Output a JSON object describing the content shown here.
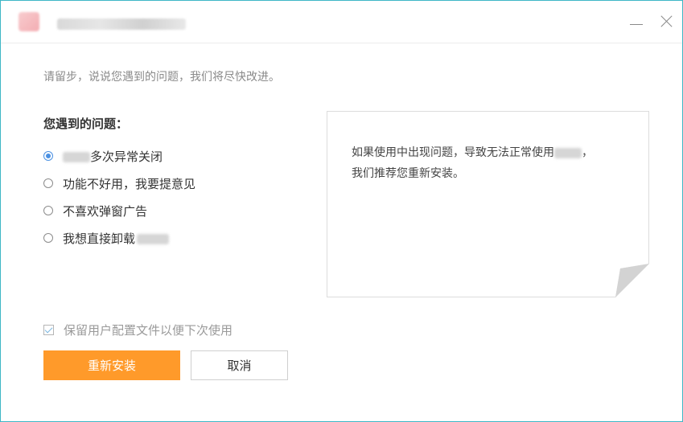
{
  "intro": "请留步，说说您遇到的问题，我们将尽快改进。",
  "question_title": "您遇到的问题：",
  "options": [
    {
      "label": "多次异常关闭",
      "checked": true
    },
    {
      "label": "功能不好用，我要提意见",
      "checked": false
    },
    {
      "label": "不喜欢弹窗广告",
      "checked": false
    },
    {
      "label": "我想直接卸载",
      "checked": false
    }
  ],
  "note": {
    "line1": "如果使用中出现问题，导致无法正常使用",
    "line1_suffix": "，",
    "line2": "我们推荐您重新安装。"
  },
  "keep_config_label": "保留用户配置文件以便下次使用",
  "reinstall_label": "重新安装",
  "cancel_label": "取消",
  "colors": {
    "accent": "#ff9a2a",
    "radio": "#4a90e2",
    "border": "#3fb7c6"
  }
}
